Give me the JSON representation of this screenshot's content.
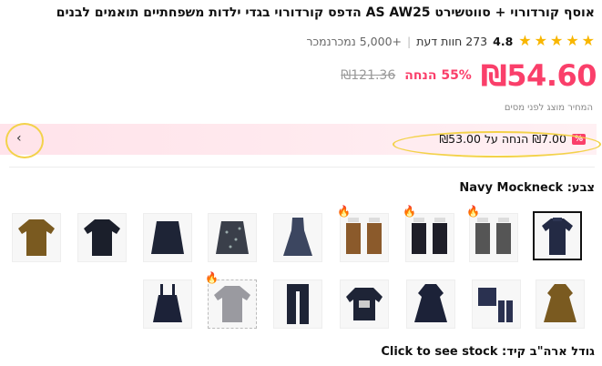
{
  "product": {
    "title": "אוסף קורדורוי + סווטשירט AS AW25 הדפס קורדורוי בגדי ילדות משפחתיים תואמים לבנים",
    "rating": "4.8",
    "reviews": "273 חוות דעת",
    "sold": "+5,000 נמכרנמכר"
  },
  "price": {
    "current": "₪54.60",
    "discount": "55% הנחה",
    "original": "₪121.36",
    "tax_note": "המחיר מוצג לפני מסים"
  },
  "promo": {
    "badge": "%",
    "text": "₪7.00 הנחה על ₪53.00"
  },
  "colors": {
    "label": "צבע: Navy Mockneck"
  },
  "size": {
    "label": "גודל ארה\"ב קיד: Click to see stock"
  },
  "palette": {
    "accent": "#fa3f6a",
    "star": "#f8b600",
    "highlight": "#f3d24a"
  }
}
